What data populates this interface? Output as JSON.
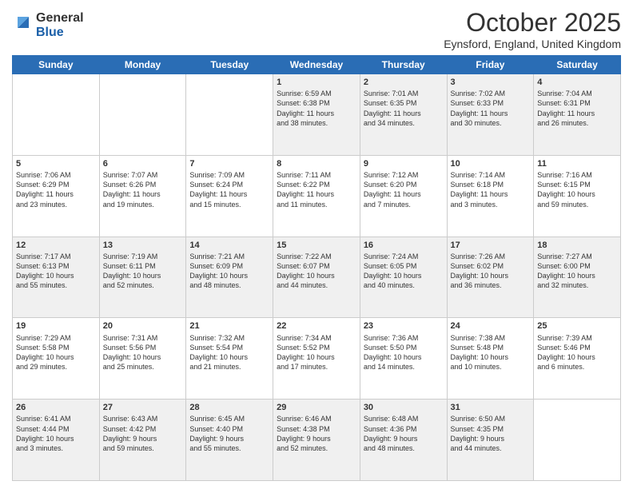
{
  "header": {
    "logo_general": "General",
    "logo_blue": "Blue",
    "month_title": "October 2025",
    "location": "Eynsford, England, United Kingdom"
  },
  "weekdays": [
    "Sunday",
    "Monday",
    "Tuesday",
    "Wednesday",
    "Thursday",
    "Friday",
    "Saturday"
  ],
  "weeks": [
    [
      {
        "day": "",
        "info": ""
      },
      {
        "day": "",
        "info": ""
      },
      {
        "day": "",
        "info": ""
      },
      {
        "day": "1",
        "info": "Sunrise: 6:59 AM\nSunset: 6:38 PM\nDaylight: 11 hours\nand 38 minutes."
      },
      {
        "day": "2",
        "info": "Sunrise: 7:01 AM\nSunset: 6:35 PM\nDaylight: 11 hours\nand 34 minutes."
      },
      {
        "day": "3",
        "info": "Sunrise: 7:02 AM\nSunset: 6:33 PM\nDaylight: 11 hours\nand 30 minutes."
      },
      {
        "day": "4",
        "info": "Sunrise: 7:04 AM\nSunset: 6:31 PM\nDaylight: 11 hours\nand 26 minutes."
      }
    ],
    [
      {
        "day": "5",
        "info": "Sunrise: 7:06 AM\nSunset: 6:29 PM\nDaylight: 11 hours\nand 23 minutes."
      },
      {
        "day": "6",
        "info": "Sunrise: 7:07 AM\nSunset: 6:26 PM\nDaylight: 11 hours\nand 19 minutes."
      },
      {
        "day": "7",
        "info": "Sunrise: 7:09 AM\nSunset: 6:24 PM\nDaylight: 11 hours\nand 15 minutes."
      },
      {
        "day": "8",
        "info": "Sunrise: 7:11 AM\nSunset: 6:22 PM\nDaylight: 11 hours\nand 11 minutes."
      },
      {
        "day": "9",
        "info": "Sunrise: 7:12 AM\nSunset: 6:20 PM\nDaylight: 11 hours\nand 7 minutes."
      },
      {
        "day": "10",
        "info": "Sunrise: 7:14 AM\nSunset: 6:18 PM\nDaylight: 11 hours\nand 3 minutes."
      },
      {
        "day": "11",
        "info": "Sunrise: 7:16 AM\nSunset: 6:15 PM\nDaylight: 10 hours\nand 59 minutes."
      }
    ],
    [
      {
        "day": "12",
        "info": "Sunrise: 7:17 AM\nSunset: 6:13 PM\nDaylight: 10 hours\nand 55 minutes."
      },
      {
        "day": "13",
        "info": "Sunrise: 7:19 AM\nSunset: 6:11 PM\nDaylight: 10 hours\nand 52 minutes."
      },
      {
        "day": "14",
        "info": "Sunrise: 7:21 AM\nSunset: 6:09 PM\nDaylight: 10 hours\nand 48 minutes."
      },
      {
        "day": "15",
        "info": "Sunrise: 7:22 AM\nSunset: 6:07 PM\nDaylight: 10 hours\nand 44 minutes."
      },
      {
        "day": "16",
        "info": "Sunrise: 7:24 AM\nSunset: 6:05 PM\nDaylight: 10 hours\nand 40 minutes."
      },
      {
        "day": "17",
        "info": "Sunrise: 7:26 AM\nSunset: 6:02 PM\nDaylight: 10 hours\nand 36 minutes."
      },
      {
        "day": "18",
        "info": "Sunrise: 7:27 AM\nSunset: 6:00 PM\nDaylight: 10 hours\nand 32 minutes."
      }
    ],
    [
      {
        "day": "19",
        "info": "Sunrise: 7:29 AM\nSunset: 5:58 PM\nDaylight: 10 hours\nand 29 minutes."
      },
      {
        "day": "20",
        "info": "Sunrise: 7:31 AM\nSunset: 5:56 PM\nDaylight: 10 hours\nand 25 minutes."
      },
      {
        "day": "21",
        "info": "Sunrise: 7:32 AM\nSunset: 5:54 PM\nDaylight: 10 hours\nand 21 minutes."
      },
      {
        "day": "22",
        "info": "Sunrise: 7:34 AM\nSunset: 5:52 PM\nDaylight: 10 hours\nand 17 minutes."
      },
      {
        "day": "23",
        "info": "Sunrise: 7:36 AM\nSunset: 5:50 PM\nDaylight: 10 hours\nand 14 minutes."
      },
      {
        "day": "24",
        "info": "Sunrise: 7:38 AM\nSunset: 5:48 PM\nDaylight: 10 hours\nand 10 minutes."
      },
      {
        "day": "25",
        "info": "Sunrise: 7:39 AM\nSunset: 5:46 PM\nDaylight: 10 hours\nand 6 minutes."
      }
    ],
    [
      {
        "day": "26",
        "info": "Sunrise: 6:41 AM\nSunset: 4:44 PM\nDaylight: 10 hours\nand 3 minutes."
      },
      {
        "day": "27",
        "info": "Sunrise: 6:43 AM\nSunset: 4:42 PM\nDaylight: 9 hours\nand 59 minutes."
      },
      {
        "day": "28",
        "info": "Sunrise: 6:45 AM\nSunset: 4:40 PM\nDaylight: 9 hours\nand 55 minutes."
      },
      {
        "day": "29",
        "info": "Sunrise: 6:46 AM\nSunset: 4:38 PM\nDaylight: 9 hours\nand 52 minutes."
      },
      {
        "day": "30",
        "info": "Sunrise: 6:48 AM\nSunset: 4:36 PM\nDaylight: 9 hours\nand 48 minutes."
      },
      {
        "day": "31",
        "info": "Sunrise: 6:50 AM\nSunset: 4:35 PM\nDaylight: 9 hours\nand 44 minutes."
      },
      {
        "day": "",
        "info": ""
      }
    ]
  ]
}
